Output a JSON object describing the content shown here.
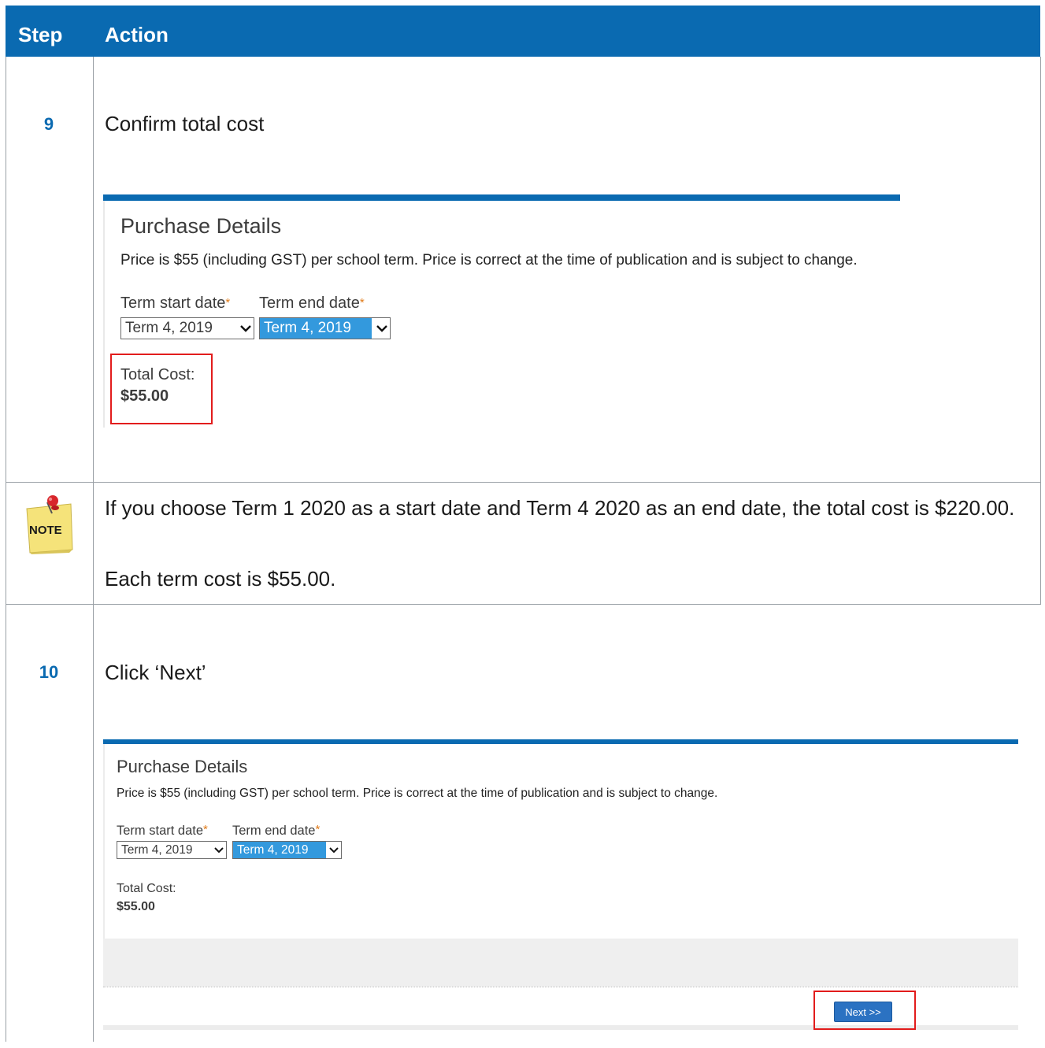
{
  "header": {
    "step": "Step",
    "action": "Action"
  },
  "rows": [
    {
      "step": "9",
      "instruction": "Confirm total cost",
      "screenshot": {
        "title": "Purchase Details",
        "description": "Price is $55 (including GST) per school term. Price is correct at the time of publication and is subject to change.",
        "start_label": "Term start date",
        "end_label": "Term end date",
        "required_mark": "*",
        "start_value": "Term 4, 2019",
        "end_value": "Term 4, 2019",
        "total_label": "Total Cost:",
        "total_value": "$55.00"
      }
    },
    {
      "note_icon_text": "NOTE",
      "lines": [
        "If you choose Term 1 2020 as a start date and Term 4 2020 as an end date, the total cost is $220.00.",
        "Each term cost is $55.00."
      ]
    },
    {
      "step": "10",
      "instruction": "Click ‘Next’",
      "screenshot": {
        "title": "Purchase Details",
        "description": "Price is $55 (including GST) per school term. Price is correct at the time of publication and is subject to change.",
        "start_label": "Term start date",
        "end_label": "Term end date",
        "required_mark": "*",
        "start_value": "Term 4, 2019",
        "end_value": "Term 4, 2019",
        "total_label": "Total Cost:",
        "total_value": "$55.00",
        "next_button": "Next >>"
      }
    }
  ],
  "colors": {
    "header": "#0a6ab1",
    "step_number": "#0a6ab1",
    "highlight": "#e21c1c"
  },
  "icons": {
    "note": "pushpin-note-icon",
    "dropdown": "chevron-down-icon"
  }
}
